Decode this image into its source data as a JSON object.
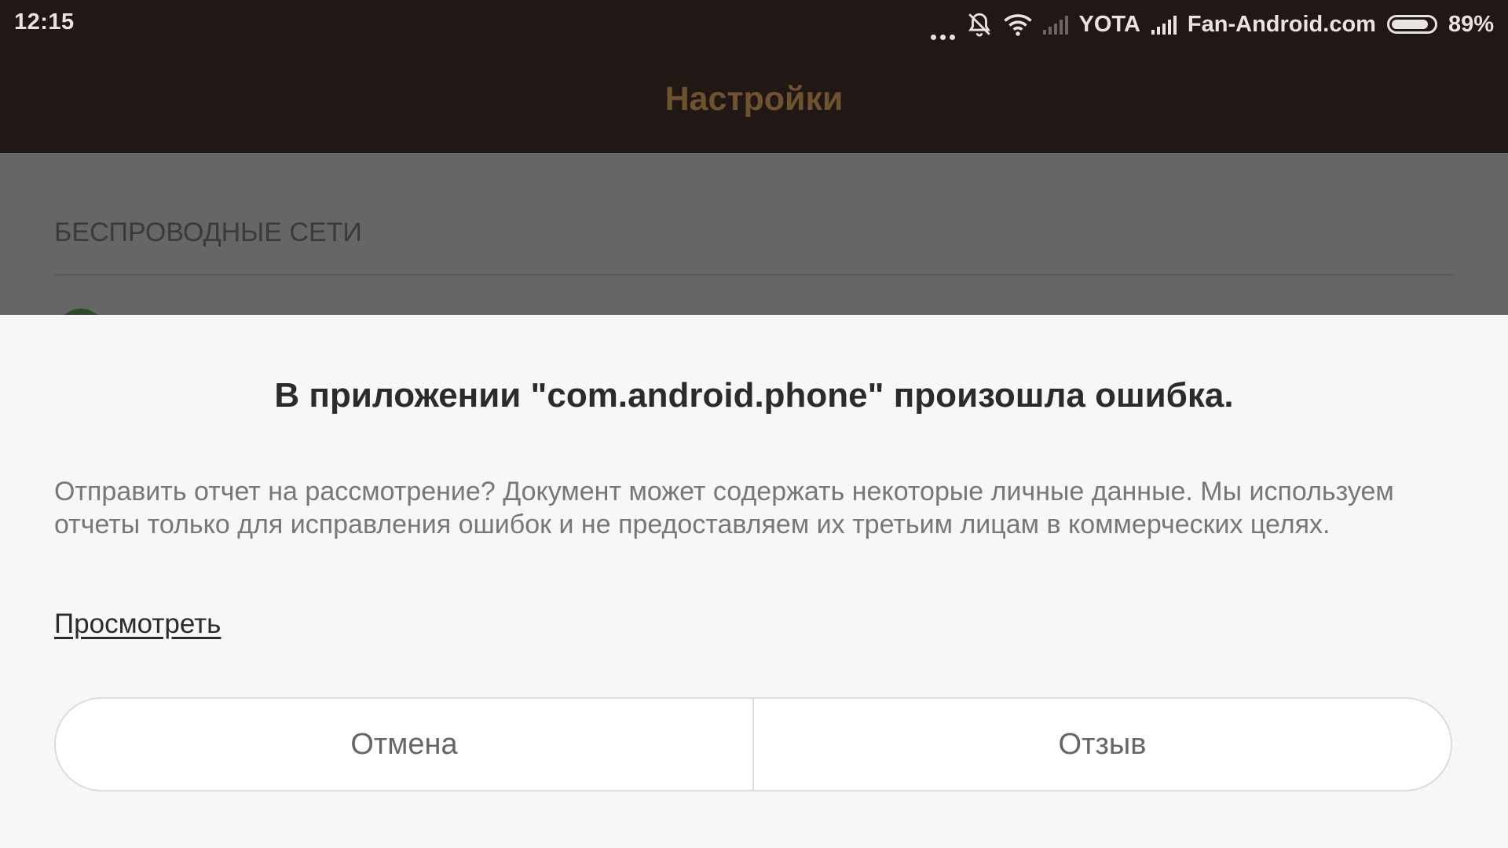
{
  "status_bar": {
    "time": "12:15",
    "carrier": "YOTA",
    "network_name": "Fan-Android.com",
    "battery_percent": "89%",
    "battery_level": 0.89,
    "icons": [
      "more-dots-icon",
      "alarm-off-icon",
      "wifi-icon",
      "signal-empty-icon",
      "signal-icon",
      "battery-icon"
    ]
  },
  "action_bar": {
    "title": "Настройки",
    "title_color": "#6e5330"
  },
  "settings": {
    "section_header": "БЕСПРОВОДНЫЕ СЕТИ"
  },
  "dialog": {
    "title": "В приложении \"com.android.phone\" произошла ошибка.",
    "message": "Отправить отчет на рассмотрение? Документ может содержать некоторые личные данные. Мы используем отчеты только для исправления ошибок и не предоставляем их третьим лицам в коммерческих целях.",
    "view_link": "Просмотреть",
    "cancel_label": "Отмена",
    "feedback_label": "Отзыв"
  }
}
